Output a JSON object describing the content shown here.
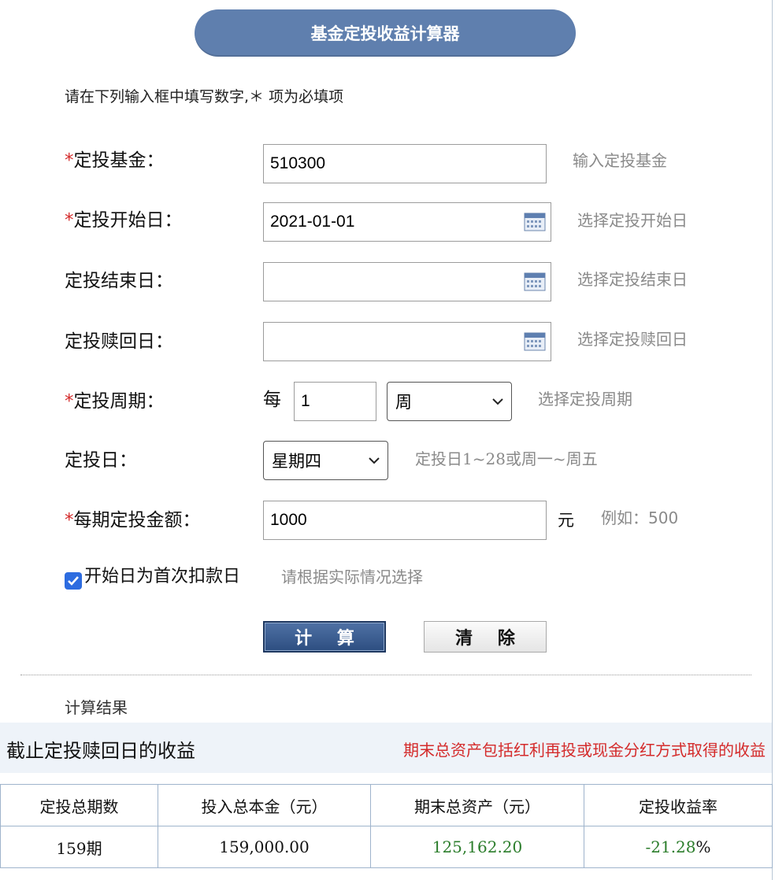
{
  "title": "基金定投收益计算器",
  "instruction": "请在下列输入框中填写数字,＊ 项为必填项",
  "required_mark": "*",
  "form": {
    "fund": {
      "label": "定投基金：",
      "required": true,
      "value": "510300",
      "hint": "输入定投基金"
    },
    "start_date": {
      "label": "定投开始日：",
      "required": true,
      "value": "2021-01-01",
      "hint": "选择定投开始日",
      "icon": "calendar-icon"
    },
    "end_date": {
      "label": "定投结束日：",
      "required": false,
      "value": "",
      "hint": "选择定投结束日",
      "icon": "calendar-icon"
    },
    "redeem_date": {
      "label": "定投赎回日：",
      "required": false,
      "value": "",
      "hint": "选择定投赎回日",
      "icon": "calendar-icon"
    },
    "period": {
      "label": "定投周期：",
      "required": true,
      "prefix": "每",
      "count": "1",
      "unit": "周",
      "hint": "选择定投周期"
    },
    "invest_day": {
      "label": "定投日：",
      "required": false,
      "value": "星期四",
      "hint": "定投日1~28或周一~周五"
    },
    "amount": {
      "label": "每期定投金额：",
      "required": true,
      "value": "1000",
      "unit": "元",
      "hint": "例如：500"
    },
    "first_debit": {
      "checked": true,
      "label": "开始日为首次扣款日",
      "hint": "请根据实际情况选择"
    }
  },
  "buttons": {
    "calculate": "计 算",
    "clear": "清 除"
  },
  "result": {
    "heading": "计算结果",
    "bar_title": "截止定投赎回日的收益",
    "bar_note": "期末总资产包括红利再投或现金分红方式取得的收益",
    "columns": [
      "定投总期数",
      "投入总本金（元）",
      "期末总资产（元）",
      "定投收益率"
    ],
    "row": {
      "periods": "159期",
      "principal": "159,000.00",
      "final_assets": "125,162.20",
      "return_rate": "-21.28",
      "percent_sign": "%"
    }
  },
  "colors": {
    "title_bg": "#5f7fae",
    "required": "#d42b2b",
    "hint": "#8a8a8a",
    "positive_green": "#2b7d2b",
    "checkbox": "#2d6ce0"
  }
}
